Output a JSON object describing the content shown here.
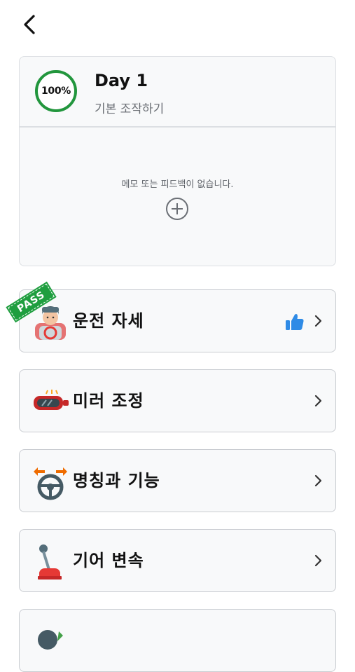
{
  "day": {
    "progress_label": "100%",
    "title": "Day 1",
    "subtitle": "기본 조작하기",
    "memo_empty": "메모 또는 피드백이 없습니다."
  },
  "lessons": [
    {
      "label": "운전 자세",
      "badge": "PASS",
      "icon": "driver-seat-icon",
      "liked": true
    },
    {
      "label": "미러 조정",
      "icon": "mirror-icon"
    },
    {
      "label": "명칭과 기능",
      "icon": "steering-wheel-icon"
    },
    {
      "label": "기어 변속",
      "icon": "gear-shift-icon"
    }
  ],
  "colors": {
    "progress": "#22963d",
    "pass_badge": "#1f9e3f",
    "thumb": "#2f8be6"
  }
}
